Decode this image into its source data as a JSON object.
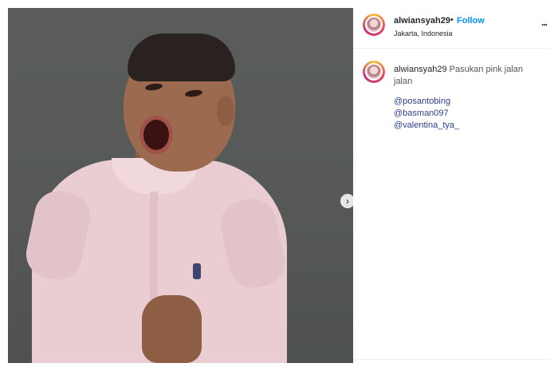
{
  "post": {
    "photo_alt": "",
    "carousel_next_glyph": "›"
  },
  "header": {
    "username": "alwiansyah29",
    "separator": "•",
    "follow_label": "Follow",
    "location": "Jakarta, Indonesia",
    "more_glyph": "..."
  },
  "caption": {
    "username": "alwiansyah29",
    "text": "Pasukan pink jalan jalan",
    "mentions": [
      "@posantobing",
      "@basman097",
      "@valentina_tya_"
    ]
  },
  "colors": {
    "link_blue": "#0095f6",
    "mention_blue": "#2c3e8c",
    "text": "#262626"
  }
}
